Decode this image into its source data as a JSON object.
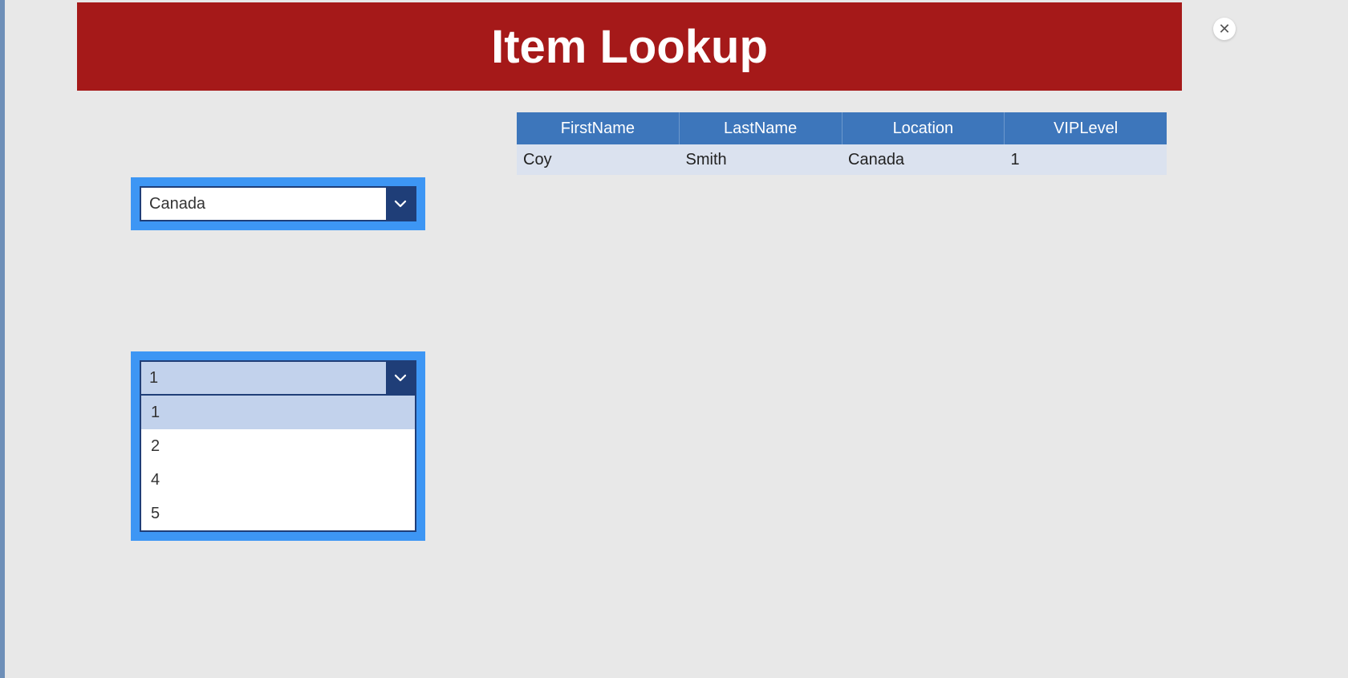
{
  "header": {
    "title": "Item Lookup"
  },
  "close": {
    "glyph": "✕"
  },
  "table": {
    "columns": [
      "FirstName",
      "LastName",
      "Location",
      "VIPLevel"
    ],
    "rows": [
      {
        "firstName": "Coy",
        "lastName": "Smith",
        "location": "Canada",
        "vipLevel": "1"
      }
    ]
  },
  "locationCombo": {
    "selected": "Canada"
  },
  "vipCombo": {
    "selected": "1",
    "options": [
      "1",
      "2",
      "4",
      "5"
    ],
    "highlightedIndex": 0
  }
}
